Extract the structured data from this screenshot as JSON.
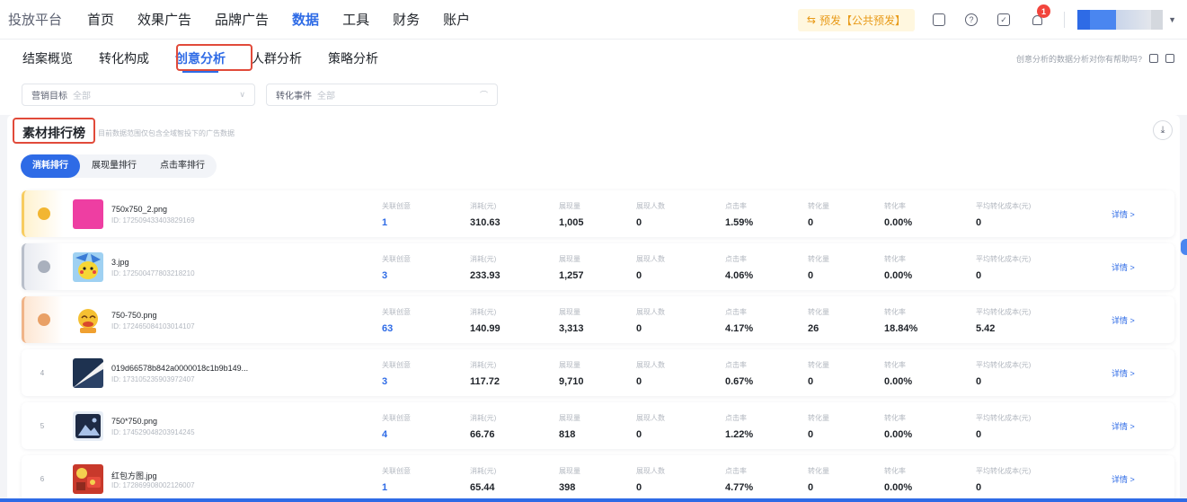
{
  "topnav": {
    "logo": "投放平台",
    "items": [
      {
        "label": "首页"
      },
      {
        "label": "效果广告"
      },
      {
        "label": "品牌广告"
      },
      {
        "label": "数据"
      },
      {
        "label": "工具"
      },
      {
        "label": "财务"
      },
      {
        "label": "账户"
      }
    ],
    "active_index": 3,
    "preview_label": "预发【公共预发】",
    "notification_count": "1"
  },
  "subnav": {
    "tabs": [
      {
        "label": "结案概览"
      },
      {
        "label": "转化构成"
      },
      {
        "label": "创意分析"
      },
      {
        "label": "人群分析"
      },
      {
        "label": "策略分析"
      }
    ],
    "active_index": 2,
    "feedback_text": "创意分析的数据分析对你有帮助吗?"
  },
  "filters": {
    "goal": {
      "label": "营销目标",
      "value": "全部"
    },
    "event": {
      "label": "转化事件",
      "value": "全部"
    }
  },
  "ranking": {
    "title": "素材排行榜",
    "note": "目前数据范围仅包含全域智投下的广告数据",
    "tabs": [
      {
        "label": "消耗排行"
      },
      {
        "label": "展现量排行"
      },
      {
        "label": "点击率排行"
      }
    ],
    "active_tab": 0,
    "metric_labels": {
      "related": "关联创意",
      "cost": "消耗(元)",
      "impressions": "展现量",
      "reach": "展现人数",
      "ctr": "点击率",
      "conversions": "转化量",
      "cvr": "转化率",
      "cpa": "平均转化成本(元)"
    },
    "detail_label": "详情 >",
    "rows": [
      {
        "rank": "1",
        "name": "750x750_2.png",
        "id": "ID: 172509433403829169",
        "related": "1",
        "cost": "310.63",
        "impressions": "1,005",
        "reach": "0",
        "ctr": "1.59%",
        "conversions": "0",
        "cvr": "0.00%",
        "cpa": "0"
      },
      {
        "rank": "2",
        "name": "3.jpg",
        "id": "ID: 172500477803218210",
        "related": "3",
        "cost": "233.93",
        "impressions": "1,257",
        "reach": "0",
        "ctr": "4.06%",
        "conversions": "0",
        "cvr": "0.00%",
        "cpa": "0"
      },
      {
        "rank": "3",
        "name": "750-750.png",
        "id": "ID: 172465084103014107",
        "related": "63",
        "cost": "140.99",
        "impressions": "3,313",
        "reach": "0",
        "ctr": "4.17%",
        "conversions": "26",
        "cvr": "18.84%",
        "cpa": "5.42"
      },
      {
        "rank": "4",
        "name": "019d66578b842a0000018c1b9b149...",
        "id": "ID: 173105235903972407",
        "related": "3",
        "cost": "117.72",
        "impressions": "9,710",
        "reach": "0",
        "ctr": "0.67%",
        "conversions": "0",
        "cvr": "0.00%",
        "cpa": "0"
      },
      {
        "rank": "5",
        "name": "750*750.png",
        "id": "ID: 174529048203914245",
        "related": "4",
        "cost": "66.76",
        "impressions": "818",
        "reach": "0",
        "ctr": "1.22%",
        "conversions": "0",
        "cvr": "0.00%",
        "cpa": "0"
      },
      {
        "rank": "6",
        "name": "红包方图.jpg",
        "id": "ID: 172869908002126007",
        "related": "1",
        "cost": "65.44",
        "impressions": "398",
        "reach": "0",
        "ctr": "4.77%",
        "conversions": "0",
        "cvr": "0.00%",
        "cpa": "0"
      }
    ]
  },
  "colors": {
    "accent": "#2e6be6",
    "highlight_box": "#e14a3a",
    "preview": "#e89a18"
  }
}
